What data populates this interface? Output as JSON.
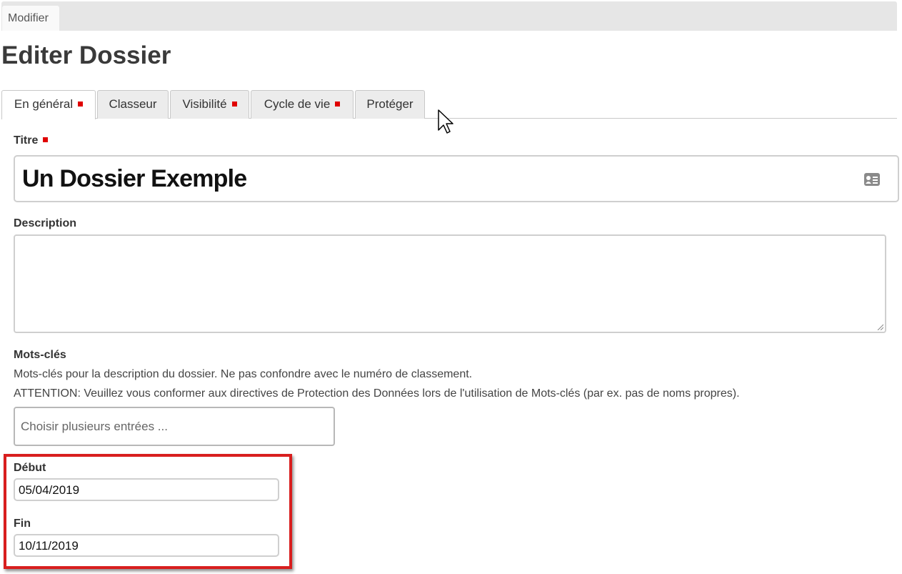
{
  "topbar": {
    "tab_label": "Modifier"
  },
  "page_title": "Editer Dossier",
  "tabs": [
    {
      "label": "En général",
      "required": true,
      "active": true
    },
    {
      "label": "Classeur",
      "required": false,
      "active": false
    },
    {
      "label": "Visibilité",
      "required": true,
      "active": false
    },
    {
      "label": "Cycle de vie",
      "required": true,
      "active": false
    },
    {
      "label": "Protéger",
      "required": false,
      "active": false
    }
  ],
  "form": {
    "title": {
      "label": "Titre",
      "required": true,
      "value": "Un Dossier Exemple",
      "icon": "id-card-icon"
    },
    "description": {
      "label": "Description",
      "value": ""
    },
    "keywords": {
      "label": "Mots-clés",
      "help_1": "Mots-clés pour la description du dossier. Ne pas confondre avec le numéro de classement.",
      "help_2": "ATTENTION: Veuillez vous conformer aux directives de Protection des Données lors de l'utilisation de Mots-clés (par ex. pas de noms propres).",
      "placeholder": "Choisir plusieurs entrées ..."
    },
    "start": {
      "label": "Début",
      "value": "05/04/2019"
    },
    "end": {
      "label": "Fin",
      "value": "10/11/2019"
    }
  },
  "colors": {
    "required_marker": "#e00000",
    "highlight_border": "#d81e1e"
  }
}
